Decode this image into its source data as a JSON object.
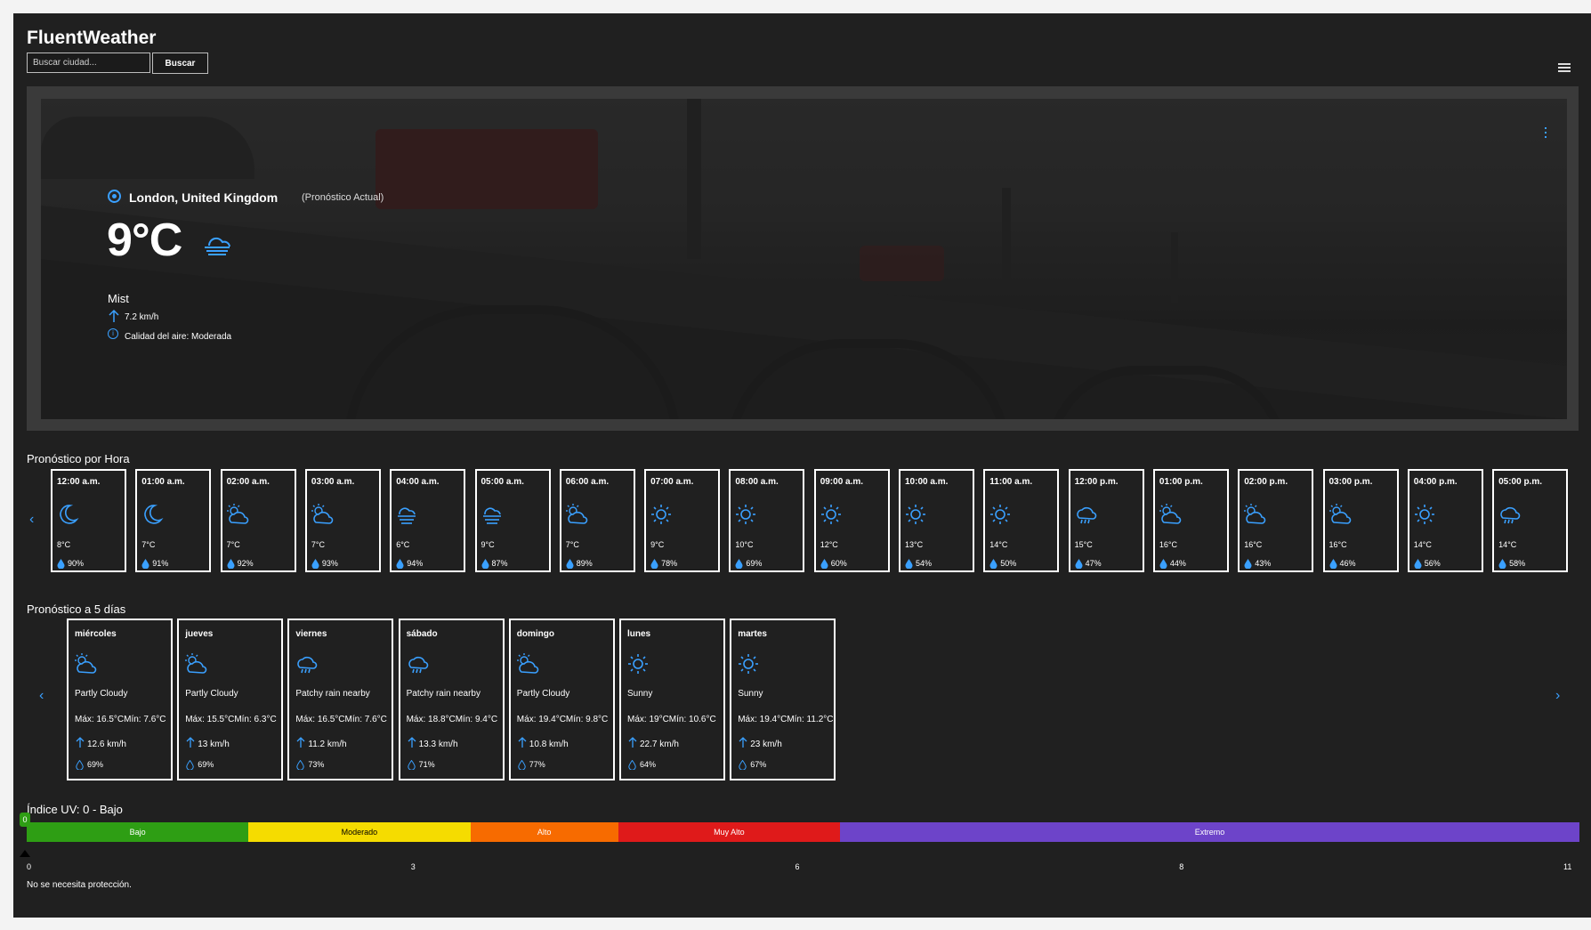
{
  "app": {
    "title": "FluentWeather"
  },
  "search": {
    "placeholder": "Buscar ciudad...",
    "button_label": "Buscar"
  },
  "current": {
    "location": "London, United Kingdom",
    "location_tag": "(Pronóstico Actual)",
    "temperature": "9°C",
    "condition": "Mist",
    "wind": "7.2 km/h",
    "air_quality": "Calidad del aire: Moderada",
    "icon": "mist-icon"
  },
  "hourly": {
    "title": "Pronóstico por Hora",
    "items": [
      {
        "time": "12:00 a.m.",
        "temp": "8°C",
        "humidity": "90%",
        "icon": "moon"
      },
      {
        "time": "01:00 a.m.",
        "temp": "7°C",
        "humidity": "91%",
        "icon": "moon"
      },
      {
        "time": "02:00 a.m.",
        "temp": "7°C",
        "humidity": "92%",
        "icon": "partly-cloudy"
      },
      {
        "time": "03:00 a.m.",
        "temp": "7°C",
        "humidity": "93%",
        "icon": "partly-cloudy"
      },
      {
        "time": "04:00 a.m.",
        "temp": "6°C",
        "humidity": "94%",
        "icon": "mist"
      },
      {
        "time": "05:00 a.m.",
        "temp": "9°C",
        "humidity": "87%",
        "icon": "mist"
      },
      {
        "time": "06:00 a.m.",
        "temp": "7°C",
        "humidity": "89%",
        "icon": "partly-cloudy"
      },
      {
        "time": "07:00 a.m.",
        "temp": "9°C",
        "humidity": "78%",
        "icon": "sun"
      },
      {
        "time": "08:00 a.m.",
        "temp": "10°C",
        "humidity": "69%",
        "icon": "sun"
      },
      {
        "time": "09:00 a.m.",
        "temp": "12°C",
        "humidity": "60%",
        "icon": "sun"
      },
      {
        "time": "10:00 a.m.",
        "temp": "13°C",
        "humidity": "54%",
        "icon": "sun"
      },
      {
        "time": "11:00 a.m.",
        "temp": "14°C",
        "humidity": "50%",
        "icon": "sun"
      },
      {
        "time": "12:00 p.m.",
        "temp": "15°C",
        "humidity": "47%",
        "icon": "rain"
      },
      {
        "time": "01:00 p.m.",
        "temp": "16°C",
        "humidity": "44%",
        "icon": "partly-cloudy"
      },
      {
        "time": "02:00 p.m.",
        "temp": "16°C",
        "humidity": "43%",
        "icon": "partly-cloudy"
      },
      {
        "time": "03:00 p.m.",
        "temp": "16°C",
        "humidity": "46%",
        "icon": "partly-cloudy"
      },
      {
        "time": "04:00 p.m.",
        "temp": "14°C",
        "humidity": "56%",
        "icon": "sun"
      },
      {
        "time": "05:00 p.m.",
        "temp": "14°C",
        "humidity": "58%",
        "icon": "rain"
      }
    ]
  },
  "daily": {
    "title": "Pronóstico a 5 días",
    "items": [
      {
        "day": "miércoles",
        "condition": "Partly Cloudy",
        "minmax": "Máx: 16.5°CMín: 7.6°C",
        "wind": "12.6 km/h",
        "humidity": "69%",
        "icon": "partly-cloudy"
      },
      {
        "day": "jueves",
        "condition": "Partly Cloudy",
        "minmax": "Máx: 15.5°CMín: 6.3°C",
        "wind": "13 km/h",
        "humidity": "69%",
        "icon": "partly-cloudy"
      },
      {
        "day": "viernes",
        "condition": "Patchy rain nearby",
        "minmax": "Máx: 16.5°CMín: 7.6°C",
        "wind": "11.2 km/h",
        "humidity": "73%",
        "icon": "rain"
      },
      {
        "day": "sábado",
        "condition": "Patchy rain nearby",
        "minmax": "Máx: 18.8°CMín: 9.4°C",
        "wind": "13.3 km/h",
        "humidity": "71%",
        "icon": "rain"
      },
      {
        "day": "domingo",
        "condition": "Partly Cloudy",
        "minmax": "Máx: 19.4°CMín: 9.8°C",
        "wind": "10.8 km/h",
        "humidity": "77%",
        "icon": "partly-cloudy"
      },
      {
        "day": "lunes",
        "condition": "Sunny",
        "minmax": "Máx: 19°CMín: 10.6°C",
        "wind": "22.7 km/h",
        "humidity": "64%",
        "icon": "sun"
      },
      {
        "day": "martes",
        "condition": "Sunny",
        "minmax": "Máx: 19.4°CMín: 11.2°C",
        "wind": "23 km/h",
        "humidity": "67%",
        "icon": "sun"
      }
    ]
  },
  "uv": {
    "title": "Índice UV: 0 - Bajo",
    "value": "0",
    "value_fraction": 0,
    "note": "No se necesita protección.",
    "segments": [
      {
        "label": "Bajo",
        "color": "#2e9e14",
        "span": 3
      },
      {
        "label": "Moderado",
        "color": "#f5dc00",
        "span": 3
      },
      {
        "label": "Alto",
        "color": "#f76b00",
        "span": 2
      },
      {
        "label": "Muy Alto",
        "color": "#df1a1a",
        "span": 3
      },
      {
        "label": "Extremo",
        "color": "#6d44c9",
        "span": 10
      }
    ],
    "ticks": [
      "0",
      "3",
      "6",
      "8",
      "11"
    ]
  },
  "colors": {
    "accent": "#3aa0ff",
    "background": "#202020",
    "card_border": "#ffffff"
  }
}
